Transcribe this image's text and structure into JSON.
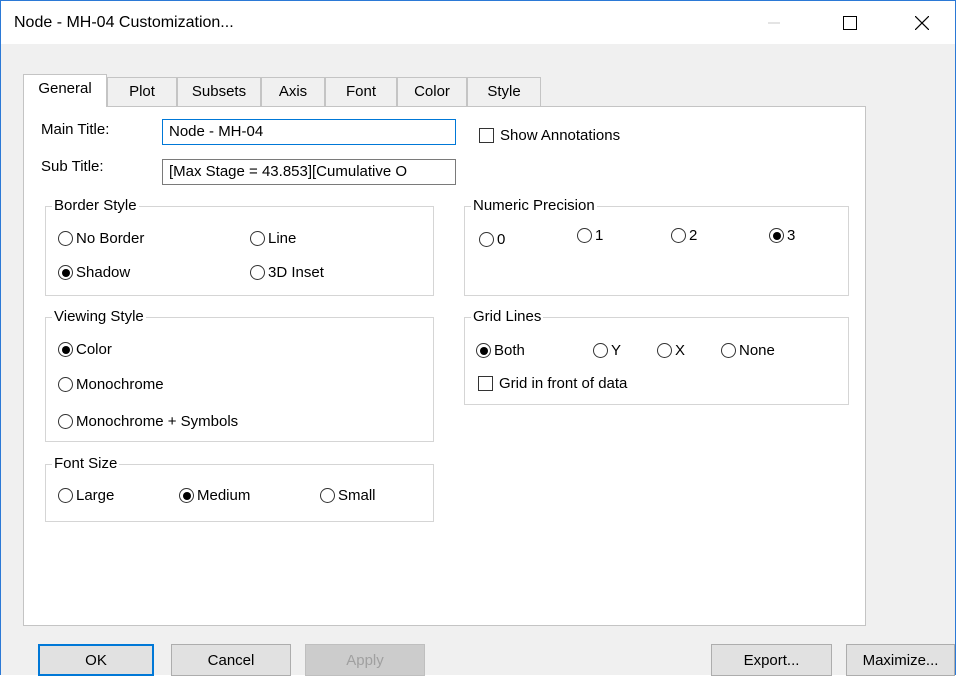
{
  "window": {
    "title": "Node - MH-04 Customization..."
  },
  "tabs": [
    {
      "label": "General",
      "active": true
    },
    {
      "label": "Plot"
    },
    {
      "label": "Subsets"
    },
    {
      "label": "Axis"
    },
    {
      "label": "Font"
    },
    {
      "label": "Color"
    },
    {
      "label": "Style"
    }
  ],
  "general": {
    "main_title_label": "Main Title:",
    "main_title_value": "Node - MH-04",
    "sub_title_label": "Sub Title:",
    "sub_title_value": "[Max Stage = 43.853][Cumulative O",
    "show_annotations_label": "Show Annotations",
    "show_annotations_checked": false
  },
  "border_style": {
    "legend": "Border Style",
    "options": [
      "No Border",
      "Line",
      "Shadow",
      "3D Inset"
    ],
    "selected": "Shadow"
  },
  "viewing_style": {
    "legend": "Viewing Style",
    "options": [
      "Color",
      "Monochrome",
      "Monochrome + Symbols"
    ],
    "selected": "Color"
  },
  "font_size": {
    "legend": "Font Size",
    "options": [
      "Large",
      "Medium",
      "Small"
    ],
    "selected": "Medium"
  },
  "numeric_precision": {
    "legend": "Numeric Precision",
    "options": [
      "0",
      "1",
      "2",
      "3"
    ],
    "selected": "3"
  },
  "grid_lines": {
    "legend": "Grid Lines",
    "options": [
      "Both",
      "Y",
      "X",
      "None"
    ],
    "selected": "Both",
    "front_label": "Grid in front of data",
    "front_checked": false
  },
  "buttons": {
    "ok": "OK",
    "cancel": "Cancel",
    "apply": "Apply",
    "export": "Export...",
    "maximize": "Maximize..."
  }
}
